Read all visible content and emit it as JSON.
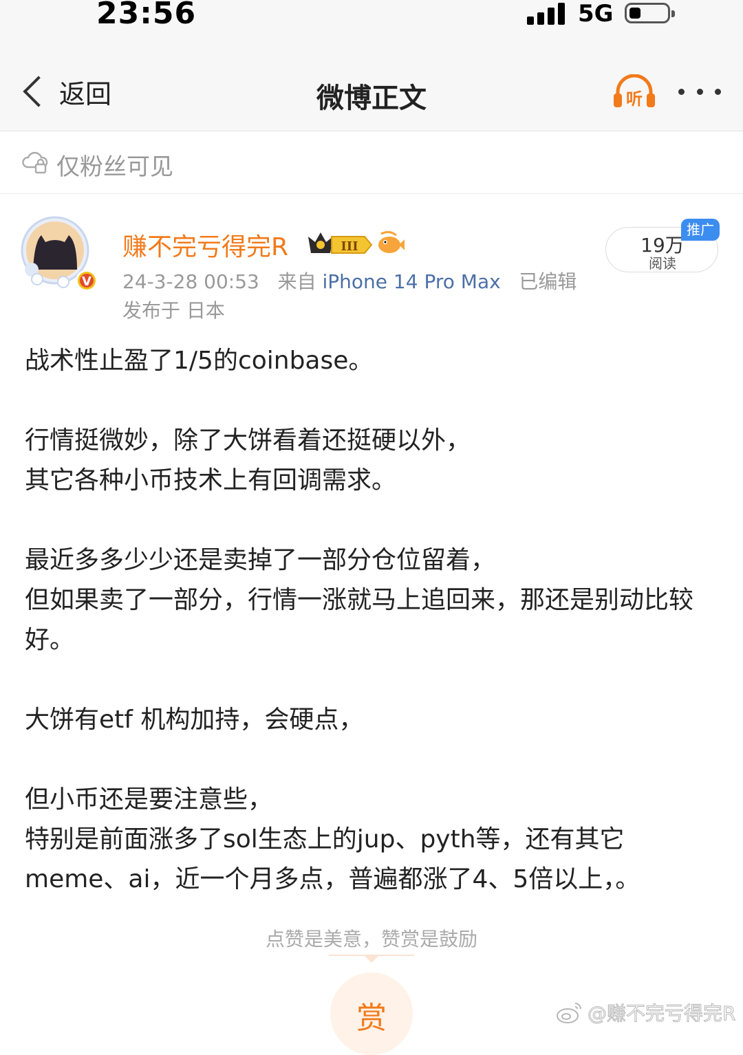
{
  "status_bar": {
    "time": "23:56",
    "network": "5G",
    "signal_bars": 4,
    "battery_level": 0.25
  },
  "nav": {
    "back_label": "返回",
    "title": "微博正文",
    "listen_label": "听",
    "accent_color": "#f27a1a"
  },
  "visibility": {
    "label": "仅粉丝可见",
    "icon": "lock-cloud-icon"
  },
  "author": {
    "name": "赚不完亏得完R",
    "verified_badge": "V",
    "level_badge": "III",
    "timestamp": "24-3-28 00:53",
    "source_prefix": "来自",
    "device": "iPhone 14 Pro Max",
    "edited": "已编辑",
    "location": "发布于 日本"
  },
  "reads": {
    "count": "19万",
    "label": "阅读",
    "promo_tag": "推广"
  },
  "post": {
    "paragraphs": [
      "战术性止盈了1/5的coinbase。",
      "行情挺微妙，除了大饼看着还挺硬以外，\n其它各种小币技术上有回调需求。",
      "最近多多少少还是卖掉了一部分仓位留着，\n但如果卖了一部分，行情一涨就马上追回来，那还是别动比较好。",
      "大饼有etf 机构加持，会硬点，",
      "但小币还是要注意些，\n特别是前面涨多了sol生态上的jup、pyth等，还有其它meme、ai，近一个月多点，普遍都涨了4、5倍以上，。"
    ]
  },
  "reward": {
    "hint": "点赞是美意，赞赏是鼓励",
    "button_label": "赏"
  },
  "watermark": {
    "text": "@赚不完亏得完R"
  }
}
